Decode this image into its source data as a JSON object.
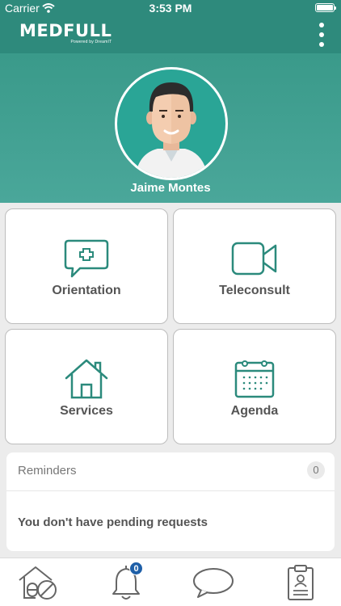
{
  "status_bar": {
    "carrier": "Carrier",
    "time": "3:53 PM",
    "battery_level": 1.0
  },
  "app_bar": {
    "logo_text": "MEDFULL",
    "powered_by": "Powered by  DreamIT",
    "menu_icon": "more-vertical-icon"
  },
  "profile": {
    "name": "Jaime Montes"
  },
  "tiles": [
    {
      "label": "Orientation",
      "icon": "chat-plus-icon"
    },
    {
      "label": "Teleconsult",
      "icon": "video-camera-icon"
    },
    {
      "label": "Services",
      "icon": "house-icon"
    },
    {
      "label": "Agenda",
      "icon": "calendar-icon"
    }
  ],
  "reminders": {
    "title": "Reminders",
    "count": "0",
    "empty_message": "You don't have pending requests"
  },
  "bottom_nav": {
    "items": [
      {
        "icon": "home-pill-icon"
      },
      {
        "icon": "bell-icon",
        "badge": "0"
      },
      {
        "icon": "chat-bubble-icon"
      },
      {
        "icon": "clipboard-icon"
      }
    ]
  },
  "colors": {
    "primary": "#2e8a7c",
    "accent_icon": "#2b8a7c",
    "badge": "#1e5fa8"
  }
}
